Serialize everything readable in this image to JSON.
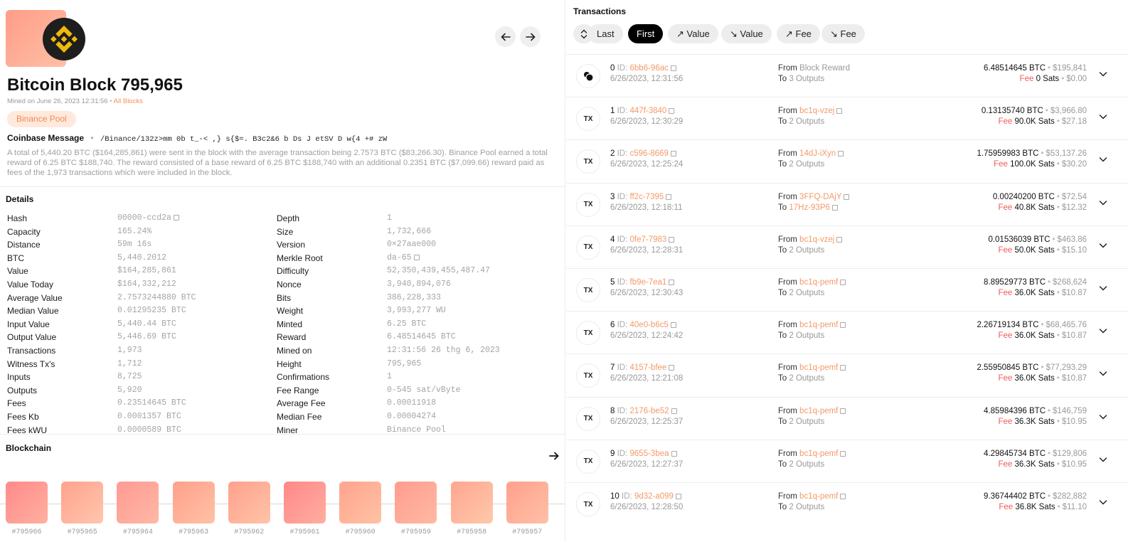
{
  "block": {
    "title": "Bitcoin Block",
    "number": "795,965",
    "mined_on": "Mined on June 26, 2023 12:31:56",
    "all_blocks": "All Blocks",
    "pool": "Binance Pool",
    "coinbase_label": "Coinbase Message",
    "coinbase_value": "/Binance/132z>mm 0b t_-< ,} s{$=. B3c2&6 b Ds  J etSV D w{4 +#   zW",
    "summary": "A total of 5,440.20 BTC ($164,285,861) were sent in the block with the average transaction being 2.7573 BTC ($83,266.30). Binance Pool earned a total reward of 6.25 BTC $188,740. The reward consisted of a base reward of 6.25 BTC $188,740 with an additional 0.2351 BTC ($7,099.66) reward paid as fees of the 1,973 transactions which were included in the block."
  },
  "details": {
    "title": "Details",
    "left": [
      {
        "k": "Hash",
        "v": "00000-ccd2a",
        "copy": true
      },
      {
        "k": "Capacity",
        "v": "165.24%"
      },
      {
        "k": "Distance",
        "v": "59m 16s"
      },
      {
        "k": "BTC",
        "v": "5,440.2012"
      },
      {
        "k": "Value",
        "v": "$164,285,861"
      },
      {
        "k": "Value Today",
        "v": "$164,332,212"
      },
      {
        "k": "Average Value",
        "v": "2.7573244880 BTC"
      },
      {
        "k": "Median Value",
        "v": "0.01295235 BTC"
      },
      {
        "k": "Input Value",
        "v": "5,440.44 BTC"
      },
      {
        "k": "Output Value",
        "v": "5,446.69 BTC"
      },
      {
        "k": "Transactions",
        "v": "1,973"
      },
      {
        "k": "Witness Tx's",
        "v": "1,712"
      },
      {
        "k": "Inputs",
        "v": "8,725"
      },
      {
        "k": "Outputs",
        "v": "5,920"
      },
      {
        "k": "Fees",
        "v": "0.23514645 BTC"
      },
      {
        "k": "Fees Kb",
        "v": "0.0001357 BTC"
      },
      {
        "k": "Fees kWU",
        "v": "0.0000589 BTC"
      }
    ],
    "right": [
      {
        "k": "Depth",
        "v": "1"
      },
      {
        "k": "Size",
        "v": "1,732,666"
      },
      {
        "k": "Version",
        "v": "0×27aae000"
      },
      {
        "k": "Merkle Root",
        "v": "da-65",
        "copy": true
      },
      {
        "k": "Difficulty",
        "v": "52,350,439,455,487.47"
      },
      {
        "k": "Nonce",
        "v": "3,940,894,076"
      },
      {
        "k": "Bits",
        "v": "386,228,333"
      },
      {
        "k": "Weight",
        "v": "3,993,277 WU"
      },
      {
        "k": "Minted",
        "v": "6.25 BTC"
      },
      {
        "k": "Reward",
        "v": "6.48514645 BTC"
      },
      {
        "k": "Mined on",
        "v": "12:31:56 26 thg 6, 2023"
      },
      {
        "k": "Height",
        "v": "795,965"
      },
      {
        "k": "Confirmations",
        "v": "1"
      },
      {
        "k": "Fee Range",
        "v": "0-545 sat/vByte"
      },
      {
        "k": "Average Fee",
        "v": "0.00011918"
      },
      {
        "k": "Median Fee",
        "v": "0.00004274"
      },
      {
        "k": "Miner",
        "v": "Binance Pool"
      }
    ]
  },
  "blockchain": {
    "title": "Blockchain",
    "blocks": [
      {
        "label": "#795966",
        "c1": "#ff8a8a",
        "c2": "#ffb0a0"
      },
      {
        "label": "#795965",
        "c1": "#ffa28c",
        "c2": "#ffc6ae"
      },
      {
        "label": "#795964",
        "c1": "#ff9a94",
        "c2": "#ffb8a4"
      },
      {
        "label": "#795963",
        "c1": "#ffa08a",
        "c2": "#ffc2a6"
      },
      {
        "label": "#795962",
        "c1": "#ffa08c",
        "c2": "#ffc4a8"
      },
      {
        "label": "#795961",
        "c1": "#ff8888",
        "c2": "#ffaea0"
      },
      {
        "label": "#795960",
        "c1": "#ffa48e",
        "c2": "#ffc2a4"
      },
      {
        "label": "#795959",
        "c1": "#ff9c8e",
        "c2": "#ffbaa4"
      },
      {
        "label": "#795958",
        "c1": "#ffa690",
        "c2": "#ffc8aa"
      },
      {
        "label": "#795957",
        "c1": "#ffa08c",
        "c2": "#ffc0a6"
      }
    ]
  },
  "transactions": {
    "title": "Transactions",
    "filters": [
      "Last",
      "First",
      "↗ Value",
      "↘ Value",
      "↗ Fee",
      "↘ Fee"
    ],
    "active_filter": "First",
    "rows": [
      {
        "icon": "coinbase",
        "idx": "0",
        "id": "6bb6-96ac",
        "time": "6/26/2023, 12:31:56",
        "from": "Block Reward",
        "from_link": false,
        "to": "3 Outputs",
        "to_link": false,
        "btc": "6.48514645 BTC",
        "usd": "$195,841",
        "fee": "0 Sats",
        "fee_usd": "$0.00"
      },
      {
        "icon": "TX",
        "idx": "1",
        "id": "447f-3840",
        "time": "6/26/2023, 12:30:29",
        "from": "bc1q-vzej",
        "from_link": true,
        "to": "2 Outputs",
        "to_link": false,
        "btc": "0.13135740 BTC",
        "usd": "$3,966.80",
        "fee": "90.0K Sats",
        "fee_usd": "$27.18"
      },
      {
        "icon": "TX",
        "idx": "2",
        "id": "c596-8669",
        "time": "6/26/2023, 12:25:24",
        "from": "14dJ-iXyn",
        "from_link": true,
        "to": "2 Outputs",
        "to_link": false,
        "btc": "1.75959983 BTC",
        "usd": "$53,137.26",
        "fee": "100.0K Sats",
        "fee_usd": "$30.20"
      },
      {
        "icon": "TX",
        "idx": "3",
        "id": "ff2c-7395",
        "time": "6/26/2023, 12:18:11",
        "from": "3FFQ-DAjY",
        "from_link": true,
        "to": "17Hz-93P6",
        "to_link": true,
        "btc": "0.00240200 BTC",
        "usd": "$72.54",
        "fee": "40.8K Sats",
        "fee_usd": "$12.32"
      },
      {
        "icon": "TX",
        "idx": "4",
        "id": "0fe7-7983",
        "time": "6/26/2023, 12:28:31",
        "from": "bc1q-vzej",
        "from_link": true,
        "to": "2 Outputs",
        "to_link": false,
        "btc": "0.01536039 BTC",
        "usd": "$463.86",
        "fee": "50.0K Sats",
        "fee_usd": "$15.10"
      },
      {
        "icon": "TX",
        "idx": "5",
        "id": "fb9e-7ea1",
        "time": "6/26/2023, 12:30:43",
        "from": "bc1q-pemf",
        "from_link": true,
        "to": "2 Outputs",
        "to_link": false,
        "btc": "8.89529773 BTC",
        "usd": "$268,624",
        "fee": "36.0K Sats",
        "fee_usd": "$10.87"
      },
      {
        "icon": "TX",
        "idx": "6",
        "id": "40e0-b6c5",
        "time": "6/26/2023, 12:24:42",
        "from": "bc1q-pemf",
        "from_link": true,
        "to": "2 Outputs",
        "to_link": false,
        "btc": "2.26719134 BTC",
        "usd": "$68,465.76",
        "fee": "36.0K Sats",
        "fee_usd": "$10.87"
      },
      {
        "icon": "TX",
        "idx": "7",
        "id": "4157-bfee",
        "time": "6/26/2023, 12:21:08",
        "from": "bc1q-pemf",
        "from_link": true,
        "to": "2 Outputs",
        "to_link": false,
        "btc": "2.55950845 BTC",
        "usd": "$77,293.29",
        "fee": "36.0K Sats",
        "fee_usd": "$10.87"
      },
      {
        "icon": "TX",
        "idx": "8",
        "id": "2176-be52",
        "time": "6/26/2023, 12:25:37",
        "from": "bc1q-pemf",
        "from_link": true,
        "to": "2 Outputs",
        "to_link": false,
        "btc": "4.85984396 BTC",
        "usd": "$146,759",
        "fee": "36.3K Sats",
        "fee_usd": "$10.95"
      },
      {
        "icon": "TX",
        "idx": "9",
        "id": "9655-3bea",
        "time": "6/26/2023, 12:27:37",
        "from": "bc1q-pemf",
        "from_link": true,
        "to": "2 Outputs",
        "to_link": false,
        "btc": "4.29845734 BTC",
        "usd": "$129,806",
        "fee": "36.3K Sats",
        "fee_usd": "$10.95"
      },
      {
        "icon": "TX",
        "idx": "10",
        "id": "9d32-a099",
        "time": "6/26/2023, 12:28:50",
        "from": "bc1q-pemf",
        "from_link": true,
        "to": "2 Outputs",
        "to_link": false,
        "btc": "9.36744402 BTC",
        "usd": "$282,882",
        "fee": "36.8K Sats",
        "fee_usd": "$11.10"
      }
    ],
    "labels": {
      "id": "ID:",
      "from": "From",
      "to": "To",
      "fee": "Fee"
    }
  },
  "colors": {
    "accent": "#f29a68",
    "fee_red": "#f05a5a",
    "binance_yellow": "#f0b90b"
  },
  "icons": [
    "binance-logo-icon",
    "arrow-left-icon",
    "arrow-right-icon",
    "copy-icon",
    "sort-icon",
    "chevron-down-icon",
    "coinbase-icon"
  ]
}
